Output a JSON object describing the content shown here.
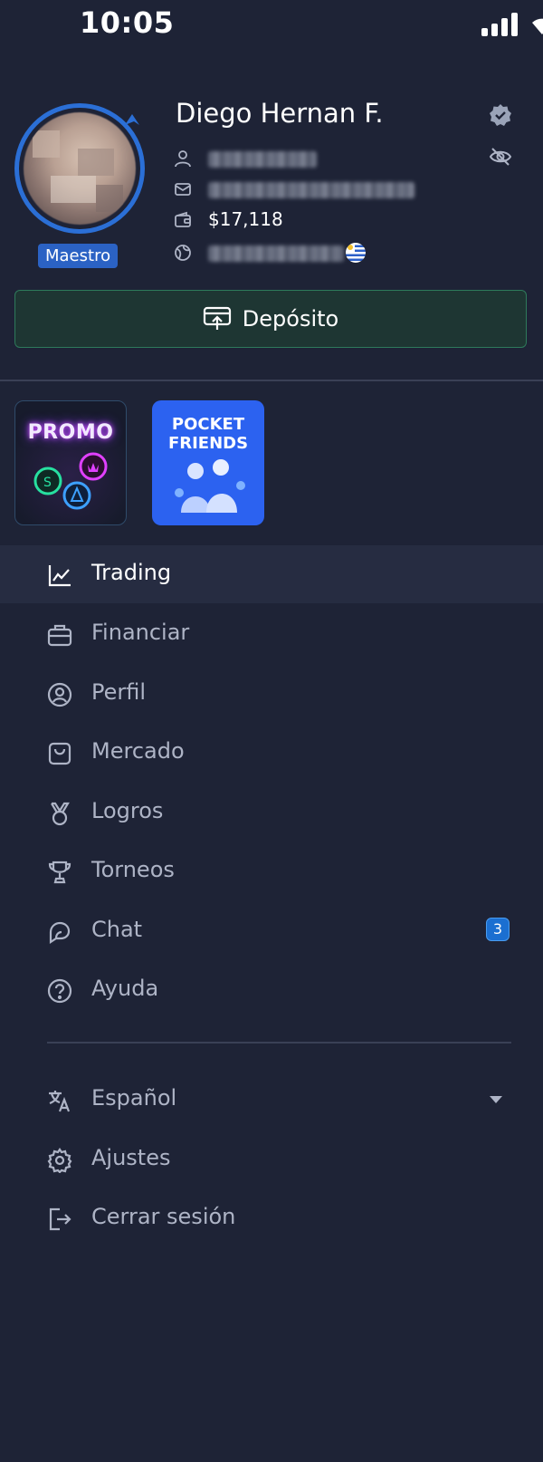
{
  "status_bar": {
    "time": "10:05"
  },
  "profile": {
    "name": "Diego Hernan F.",
    "level": "Maestro",
    "balance": "$17,118"
  },
  "deposit": {
    "label": "Depósito"
  },
  "banners": {
    "promo": "PROMO",
    "friends_line1": "POCKET",
    "friends_line2": "FRIENDS"
  },
  "menu": {
    "items": [
      {
        "label": "Trading",
        "icon": "chart-line-icon"
      },
      {
        "label": "Financiar",
        "icon": "briefcase-icon"
      },
      {
        "label": "Perfil",
        "icon": "user-circle-icon"
      },
      {
        "label": "Mercado",
        "icon": "shopping-bag-icon"
      },
      {
        "label": "Logros",
        "icon": "medal-icon"
      },
      {
        "label": "Torneos",
        "icon": "trophy-icon"
      },
      {
        "label": "Chat",
        "icon": "chat-icon",
        "badge": "3"
      },
      {
        "label": "Ayuda",
        "icon": "help-circle-icon"
      }
    ],
    "bottom": [
      {
        "label": "Español",
        "icon": "translate-icon"
      },
      {
        "label": "Ajustes",
        "icon": "gear-icon"
      },
      {
        "label": "Cerrar sesión",
        "icon": "logout-icon"
      }
    ]
  },
  "colors": {
    "background": "#1e2336",
    "accent_blue": "#2b6fd6",
    "deposit_border": "#2e7a5b",
    "badge_blue": "#1b6fd1"
  }
}
